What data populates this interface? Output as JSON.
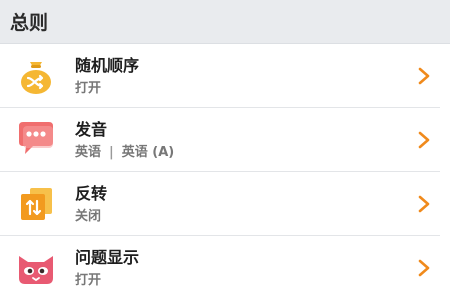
{
  "section": {
    "title": "总则"
  },
  "rows": [
    {
      "title": "随机顺序",
      "subtitle": "打开",
      "icon": "shuffle-bag-icon"
    },
    {
      "title": "发音",
      "subtitle_parts": [
        "英语",
        "|",
        "英语 (A)"
      ],
      "icon": "speech-bubble-icon"
    },
    {
      "title": "反转",
      "subtitle": "关闭",
      "icon": "swap-cards-icon"
    },
    {
      "title": "问题显示",
      "subtitle": "打开",
      "icon": "cat-face-icon"
    }
  ],
  "colors": {
    "accent": "#f08a1c",
    "header_bg": "#e9ebee",
    "bubble_pink": "#f06e6e",
    "cat_pink": "#e85a72",
    "swap_orange": "#f29a1f"
  }
}
